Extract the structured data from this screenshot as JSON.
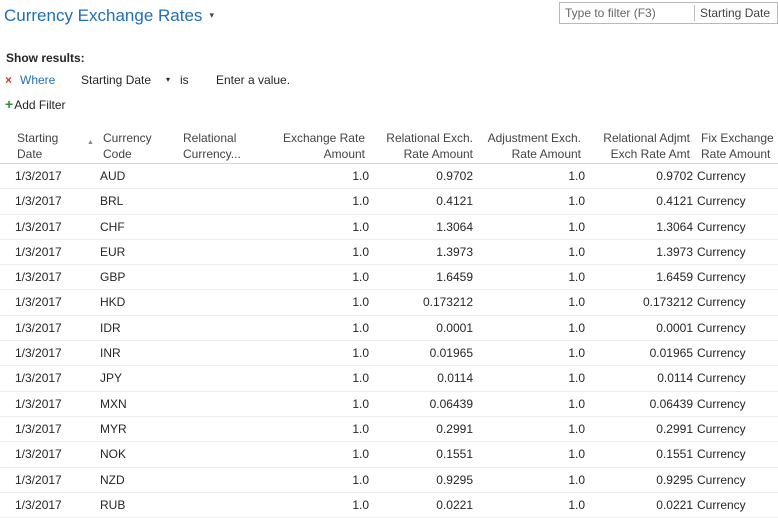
{
  "header": {
    "title": "Currency Exchange Rates",
    "title_caret": "▾",
    "filter_placeholder": "Type to filter (F3)",
    "filter_field": "Starting Date"
  },
  "filter_pane": {
    "show_results": "Show results:",
    "remove_icon": "×",
    "where": "Where",
    "field": "Starting Date",
    "field_caret": "▾",
    "operator": "is",
    "value_placeholder": "Enter a value.",
    "add_filter": "Add Filter",
    "add_icon": "+"
  },
  "columns": [
    {
      "key": "date",
      "line1": "Starting",
      "line2": "Date"
    },
    {
      "key": "code",
      "line1": "Currency",
      "line2": "Code"
    },
    {
      "key": "rel",
      "line1": "Relational",
      "line2": "Currency..."
    },
    {
      "key": "amt",
      "line1": "Exchange Rate",
      "line2": "Amount"
    },
    {
      "key": "relexch",
      "line1": "Relational Exch.",
      "line2": "Rate Amount"
    },
    {
      "key": "adj",
      "line1": "Adjustment Exch.",
      "line2": "Rate Amount"
    },
    {
      "key": "reladj",
      "line1": "Relational Adjmt",
      "line2": "Exch Rate Amt"
    },
    {
      "key": "fix",
      "line1": "Fix Exchange",
      "line2": "Rate Amount"
    }
  ],
  "sort_icon": "▲",
  "rows": [
    {
      "date": "1/3/2017",
      "code": "AUD",
      "rel": "",
      "amt": "1.0",
      "relexch": "0.9702",
      "adj": "1.0",
      "reladj": "0.9702",
      "fix": "Currency"
    },
    {
      "date": "1/3/2017",
      "code": "BRL",
      "rel": "",
      "amt": "1.0",
      "relexch": "0.4121",
      "adj": "1.0",
      "reladj": "0.4121",
      "fix": "Currency"
    },
    {
      "date": "1/3/2017",
      "code": "CHF",
      "rel": "",
      "amt": "1.0",
      "relexch": "1.3064",
      "adj": "1.0",
      "reladj": "1.3064",
      "fix": "Currency"
    },
    {
      "date": "1/3/2017",
      "code": "EUR",
      "rel": "",
      "amt": "1.0",
      "relexch": "1.3973",
      "adj": "1.0",
      "reladj": "1.3973",
      "fix": "Currency"
    },
    {
      "date": "1/3/2017",
      "code": "GBP",
      "rel": "",
      "amt": "1.0",
      "relexch": "1.6459",
      "adj": "1.0",
      "reladj": "1.6459",
      "fix": "Currency"
    },
    {
      "date": "1/3/2017",
      "code": "HKD",
      "rel": "",
      "amt": "1.0",
      "relexch": "0.173212",
      "adj": "1.0",
      "reladj": "0.173212",
      "fix": "Currency"
    },
    {
      "date": "1/3/2017",
      "code": "IDR",
      "rel": "",
      "amt": "1.0",
      "relexch": "0.0001",
      "adj": "1.0",
      "reladj": "0.0001",
      "fix": "Currency"
    },
    {
      "date": "1/3/2017",
      "code": "INR",
      "rel": "",
      "amt": "1.0",
      "relexch": "0.01965",
      "adj": "1.0",
      "reladj": "0.01965",
      "fix": "Currency"
    },
    {
      "date": "1/3/2017",
      "code": "JPY",
      "rel": "",
      "amt": "1.0",
      "relexch": "0.0114",
      "adj": "1.0",
      "reladj": "0.0114",
      "fix": "Currency"
    },
    {
      "date": "1/3/2017",
      "code": "MXN",
      "rel": "",
      "amt": "1.0",
      "relexch": "0.06439",
      "adj": "1.0",
      "reladj": "0.06439",
      "fix": "Currency"
    },
    {
      "date": "1/3/2017",
      "code": "MYR",
      "rel": "",
      "amt": "1.0",
      "relexch": "0.2991",
      "adj": "1.0",
      "reladj": "0.2991",
      "fix": "Currency"
    },
    {
      "date": "1/3/2017",
      "code": "NOK",
      "rel": "",
      "amt": "1.0",
      "relexch": "0.1551",
      "adj": "1.0",
      "reladj": "0.1551",
      "fix": "Currency"
    },
    {
      "date": "1/3/2017",
      "code": "NZD",
      "rel": "",
      "amt": "1.0",
      "relexch": "0.9295",
      "adj": "1.0",
      "reladj": "0.9295",
      "fix": "Currency"
    },
    {
      "date": "1/3/2017",
      "code": "RUB",
      "rel": "",
      "amt": "1.0",
      "relexch": "0.0221",
      "adj": "1.0",
      "reladj": "0.0221",
      "fix": "Currency"
    }
  ]
}
